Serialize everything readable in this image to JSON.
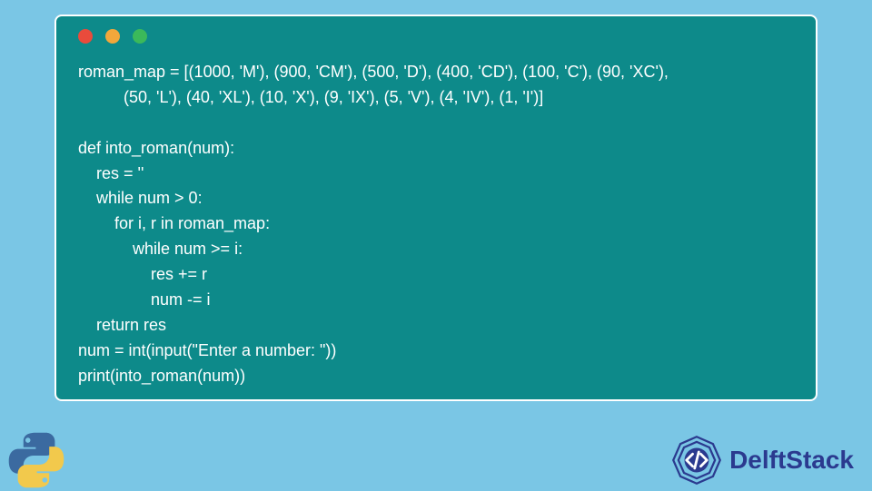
{
  "code": {
    "lines": [
      "roman_map = [(1000, 'M'), (900, 'CM'), (500, 'D'), (400, 'CD'), (100, 'C'), (90, 'XC'),",
      "          (50, 'L'), (40, 'XL'), (10, 'X'), (9, 'IX'), (5, 'V'), (4, 'IV'), (1, 'I')]",
      "",
      "def into_roman(num):",
      "    res = ''",
      "    while num > 0:",
      "        for i, r in roman_map:",
      "            while num >= i:",
      "                res += r",
      "                num -= i",
      "    return res",
      "num = int(input(\"Enter a number: \"))",
      "print(into_roman(num))"
    ]
  },
  "brand": {
    "name": "DelftStack"
  },
  "colors": {
    "page_bg": "#7ac6e5",
    "window_bg": "#0d8a8a",
    "window_border": "#ffffff",
    "code_text": "#ffffff",
    "brand_text": "#2b3a8f",
    "python_blue": "#3b6aa0",
    "python_yellow": "#f2c94c"
  }
}
